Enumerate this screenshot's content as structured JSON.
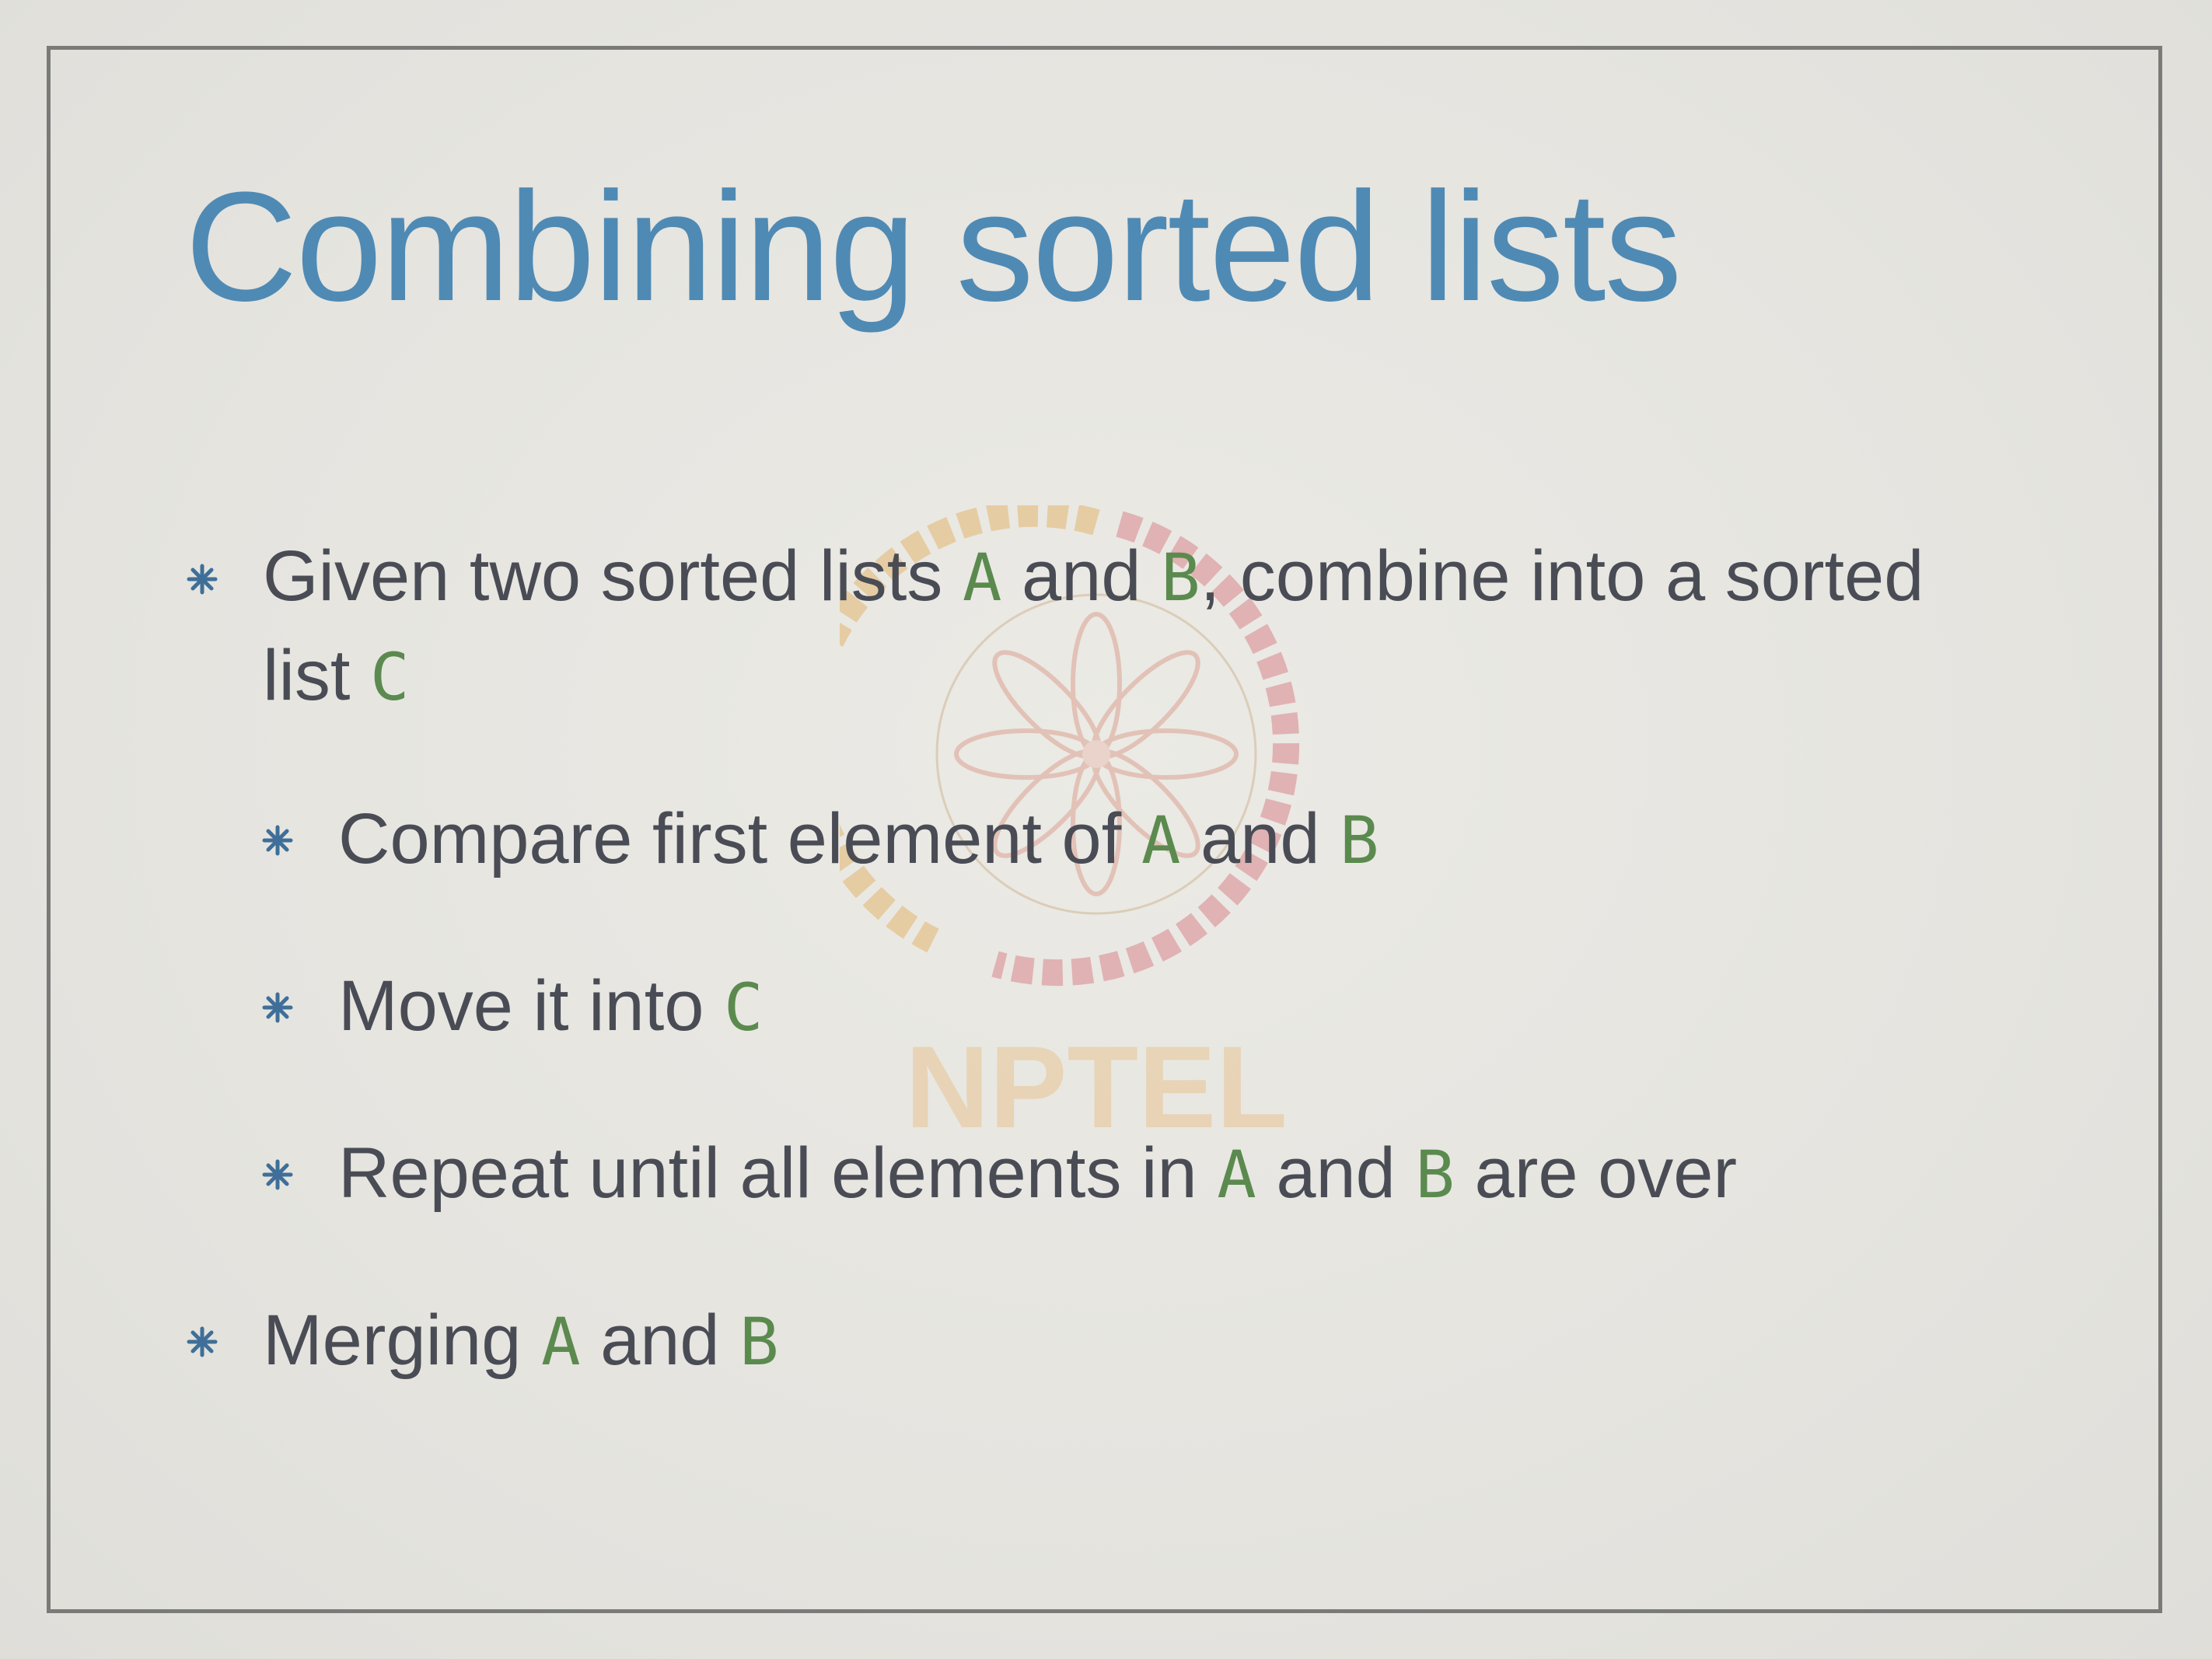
{
  "slide": {
    "title": "Combining sorted lists",
    "watermark_text": "NPTEL",
    "bullets": [
      {
        "level": 1,
        "segments": [
          {
            "text": "Given two sorted lists ",
            "code": false
          },
          {
            "text": "A",
            "code": true
          },
          {
            "text": " and ",
            "code": false
          },
          {
            "text": "B",
            "code": true
          },
          {
            "text": ", combine into a sorted list ",
            "code": false
          },
          {
            "text": "C",
            "code": true
          }
        ]
      },
      {
        "level": 2,
        "segments": [
          {
            "text": "Compare first element of ",
            "code": false
          },
          {
            "text": "A",
            "code": true
          },
          {
            "text": " and ",
            "code": false
          },
          {
            "text": "B",
            "code": true
          }
        ]
      },
      {
        "level": 2,
        "segments": [
          {
            "text": "Move it into ",
            "code": false
          },
          {
            "text": "C",
            "code": true
          }
        ]
      },
      {
        "level": 2,
        "segments": [
          {
            "text": "Repeat until all elements in ",
            "code": false
          },
          {
            "text": "A",
            "code": true
          },
          {
            "text": " and ",
            "code": false
          },
          {
            "text": "B",
            "code": true
          },
          {
            "text": " are over",
            "code": false
          }
        ]
      },
      {
        "level": 1,
        "segments": [
          {
            "text": "Merging ",
            "code": false
          },
          {
            "text": "A",
            "code": true
          },
          {
            "text": " and ",
            "code": false
          },
          {
            "text": "B",
            "code": true
          }
        ]
      }
    ]
  },
  "colors": {
    "title": "#4f8ab4",
    "body_text": "#4a4c55",
    "code_variable": "#5b8a4e",
    "bullet_icon": "#3f6f98",
    "frame": "#7a7a78"
  },
  "icons": {
    "bullet": "asterisk-bullet-icon",
    "watermark": "nptel-logo"
  }
}
